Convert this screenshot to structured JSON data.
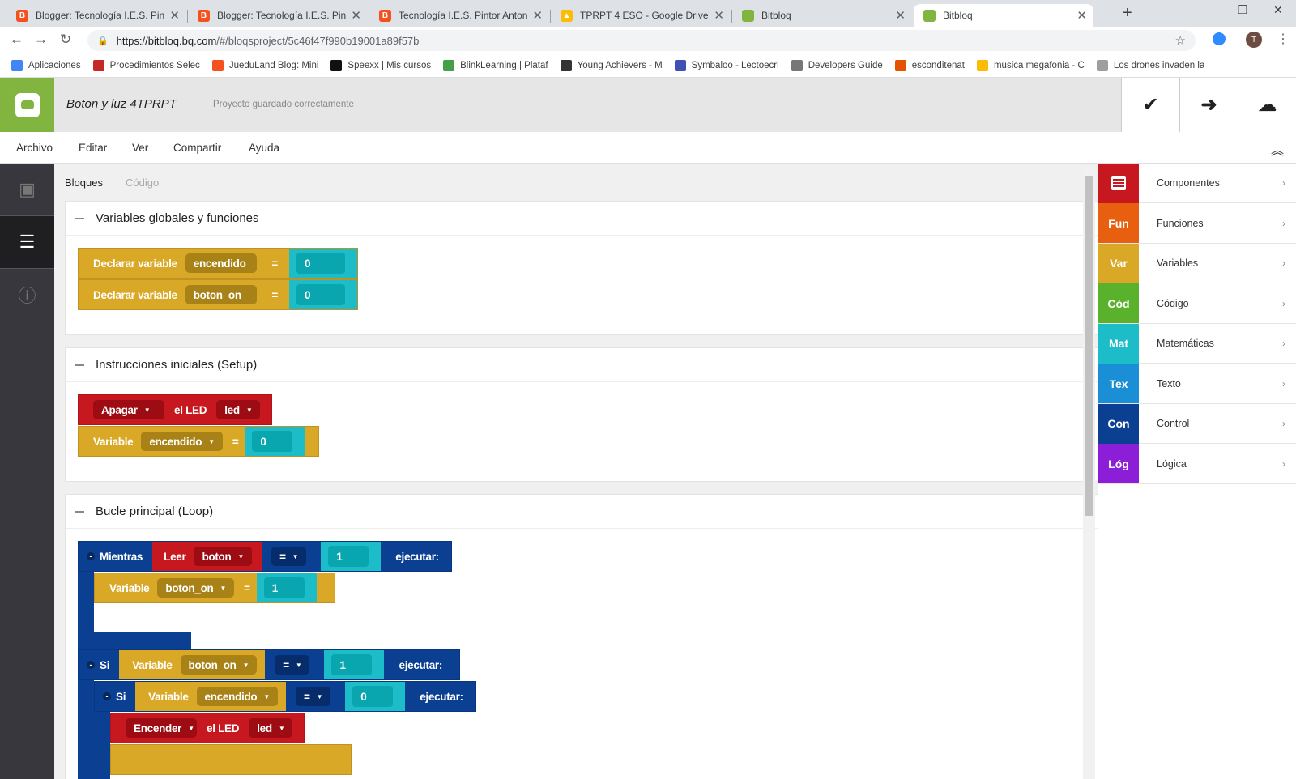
{
  "browser": {
    "tabs": [
      {
        "title": "Blogger: Tecnología I.E.S. Pintor A",
        "favicon_color": "#f4511e",
        "active": false
      },
      {
        "title": "Blogger: Tecnología I.E.S. Pintor A",
        "favicon_color": "#f4511e",
        "active": false
      },
      {
        "title": "Tecnología I.E.S. Pintor Antonio L",
        "favicon_color": "#f4511e",
        "active": false
      },
      {
        "title": "TPRPT 4 ESO - Google Drive",
        "favicon_color": "#fbbc04",
        "active": false
      },
      {
        "title": "Bitbloq",
        "favicon_color": "#82b440",
        "active": false
      },
      {
        "title": "Bitbloq",
        "favicon_color": "#82b440",
        "active": true
      }
    ],
    "url_host": "https://bitbloq.bq.com",
    "url_path": "/#/bloqsproject/5c46f47f990b19001a89f57b",
    "profile_initial": "T",
    "bookmarks": [
      {
        "label": "Aplicaciones",
        "icon_color": "#4285f4"
      },
      {
        "label": "Procedimientos Selec",
        "icon_color": "#c62828"
      },
      {
        "label": "JueduLand Blog: Mini",
        "icon_color": "#f4511e"
      },
      {
        "label": "Speexx | Mis cursos",
        "icon_color": "#111111"
      },
      {
        "label": "BlinkLearning | Plataf",
        "icon_color": "#43a047"
      },
      {
        "label": "Young Achievers - M",
        "icon_color": "#333333"
      },
      {
        "label": "Symbaloo - Lectoecri",
        "icon_color": "#3f51b5"
      },
      {
        "label": "Developers Guide",
        "icon_color": "#777777"
      },
      {
        "label": "esconditenat",
        "icon_color": "#e65100"
      },
      {
        "label": "musica megafonia - C",
        "icon_color": "#fbbc04"
      },
      {
        "label": "Los drones invaden la",
        "icon_color": "#9e9e9e"
      }
    ]
  },
  "app": {
    "project_title": "Boton y luz 4TPRPT",
    "save_status": "Proyecto guardado correctamente",
    "header_icons": [
      "check-icon",
      "arrow-right-icon",
      "cloud-icon"
    ],
    "menu": [
      "Archivo",
      "Editar",
      "Ver",
      "Compartir",
      "Ayuda"
    ],
    "rail_icons": [
      "chip-icon",
      "blocks-list-icon",
      "info-icon"
    ]
  },
  "workspace": {
    "tab_blocks": "Bloques",
    "tab_code": "Código",
    "sections": {
      "globals": {
        "title": "Variables globales y funciones",
        "blocks": [
          {
            "label": "Declarar variable",
            "name": "encendido",
            "eq": "=",
            "value": "0"
          },
          {
            "label": "Declarar variable",
            "name": "boton_on",
            "eq": "=",
            "value": "0"
          }
        ]
      },
      "setup": {
        "title": "Instrucciones iniciales (Setup)",
        "led_off": {
          "action": "Apagar",
          "mid": "el LED",
          "target": "led"
        },
        "assign": {
          "label": "Variable",
          "name": "encendido",
          "eq": "=",
          "value": "0"
        }
      },
      "loop": {
        "title": "Bucle principal (Loop)",
        "while": {
          "kw": "Mientras",
          "read": "Leer",
          "pin": "boton",
          "op": "=",
          "value": "1",
          "exec": "ejecutar:"
        },
        "while_body": {
          "label": "Variable",
          "name": "boton_on",
          "eq": "=",
          "value": "1"
        },
        "if1": {
          "kw": "Si",
          "var_label": "Variable",
          "name": "boton_on",
          "op": "=",
          "value": "1",
          "exec": "ejecutar:"
        },
        "if2": {
          "kw": "Si",
          "var_label": "Variable",
          "name": "encendido",
          "op": "=",
          "value": "0",
          "exec": "ejecutar:"
        },
        "led_on": {
          "action": "Encender",
          "mid": "el LED",
          "target": "led"
        }
      }
    }
  },
  "palette": [
    {
      "abbr": "",
      "label": "Componentes",
      "color": "#c8181f"
    },
    {
      "abbr": "Fun",
      "label": "Funciones",
      "color": "#e8600f"
    },
    {
      "abbr": "Var",
      "label": "Variables",
      "color": "#d9a826"
    },
    {
      "abbr": "Cód",
      "label": "Código",
      "color": "#5ab22c"
    },
    {
      "abbr": "Mat",
      "label": "Matemáticas",
      "color": "#1cbcc8"
    },
    {
      "abbr": "Tex",
      "label": "Texto",
      "color": "#1b8fd6"
    },
    {
      "abbr": "Con",
      "label": "Control",
      "color": "#0a3f91"
    },
    {
      "abbr": "Lóg",
      "label": "Lógica",
      "color": "#8c1ed8"
    }
  ]
}
